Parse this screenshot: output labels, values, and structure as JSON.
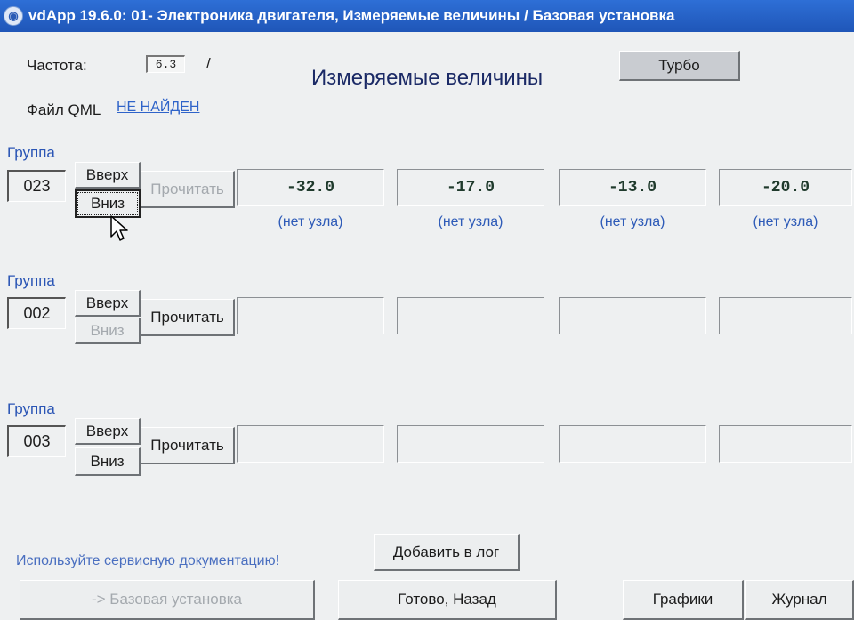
{
  "window": {
    "title": "vdApp 19.6.0: 01- Электроника двигателя, Измеряемые величины / Базовая установка",
    "icon": "app-logo-icon"
  },
  "header": {
    "frequency_label": "Частота:",
    "frequency_value": "6.3",
    "frequency_sep": "/",
    "qml_label": "Файл QML",
    "qml_link": "НЕ НАЙДЕН",
    "page_title": "Измеряемые величины",
    "turbo_label": "Турбо"
  },
  "groups": [
    {
      "label": "Группа",
      "number": "023",
      "up_label": "Вверх",
      "down_label": "Вниз",
      "read_label": "Прочитать",
      "values": [
        "-32.0",
        "-17.0",
        "-13.0",
        "-20.0"
      ],
      "units": [
        "(нет узла)",
        "(нет узла)",
        "(нет узла)",
        "(нет узла)"
      ]
    },
    {
      "label": "Группа",
      "number": "002",
      "up_label": "Вверх",
      "down_label": "Вниз",
      "read_label": "Прочитать",
      "values": [
        "",
        "",
        "",
        ""
      ],
      "units": [
        "",
        "",
        "",
        ""
      ]
    },
    {
      "label": "Группа",
      "number": "003",
      "up_label": "Вверх",
      "down_label": "Вниз",
      "read_label": "Прочитать",
      "values": [
        "",
        "",
        "",
        ""
      ],
      "units": [
        "",
        "",
        "",
        ""
      ]
    }
  ],
  "footer": {
    "hint": "Используйте сервисную документацию!",
    "add_log_label": "Добавить в лог",
    "basic_setting_label": "-> Базовая установка",
    "done_back_label": "Готово, Назад",
    "graphs_label": "Графики",
    "journal_label": "Журнал"
  },
  "colors": {
    "titlebar": "#1f56b8",
    "link": "#2e63c9",
    "group_label": "#2a55b5"
  }
}
